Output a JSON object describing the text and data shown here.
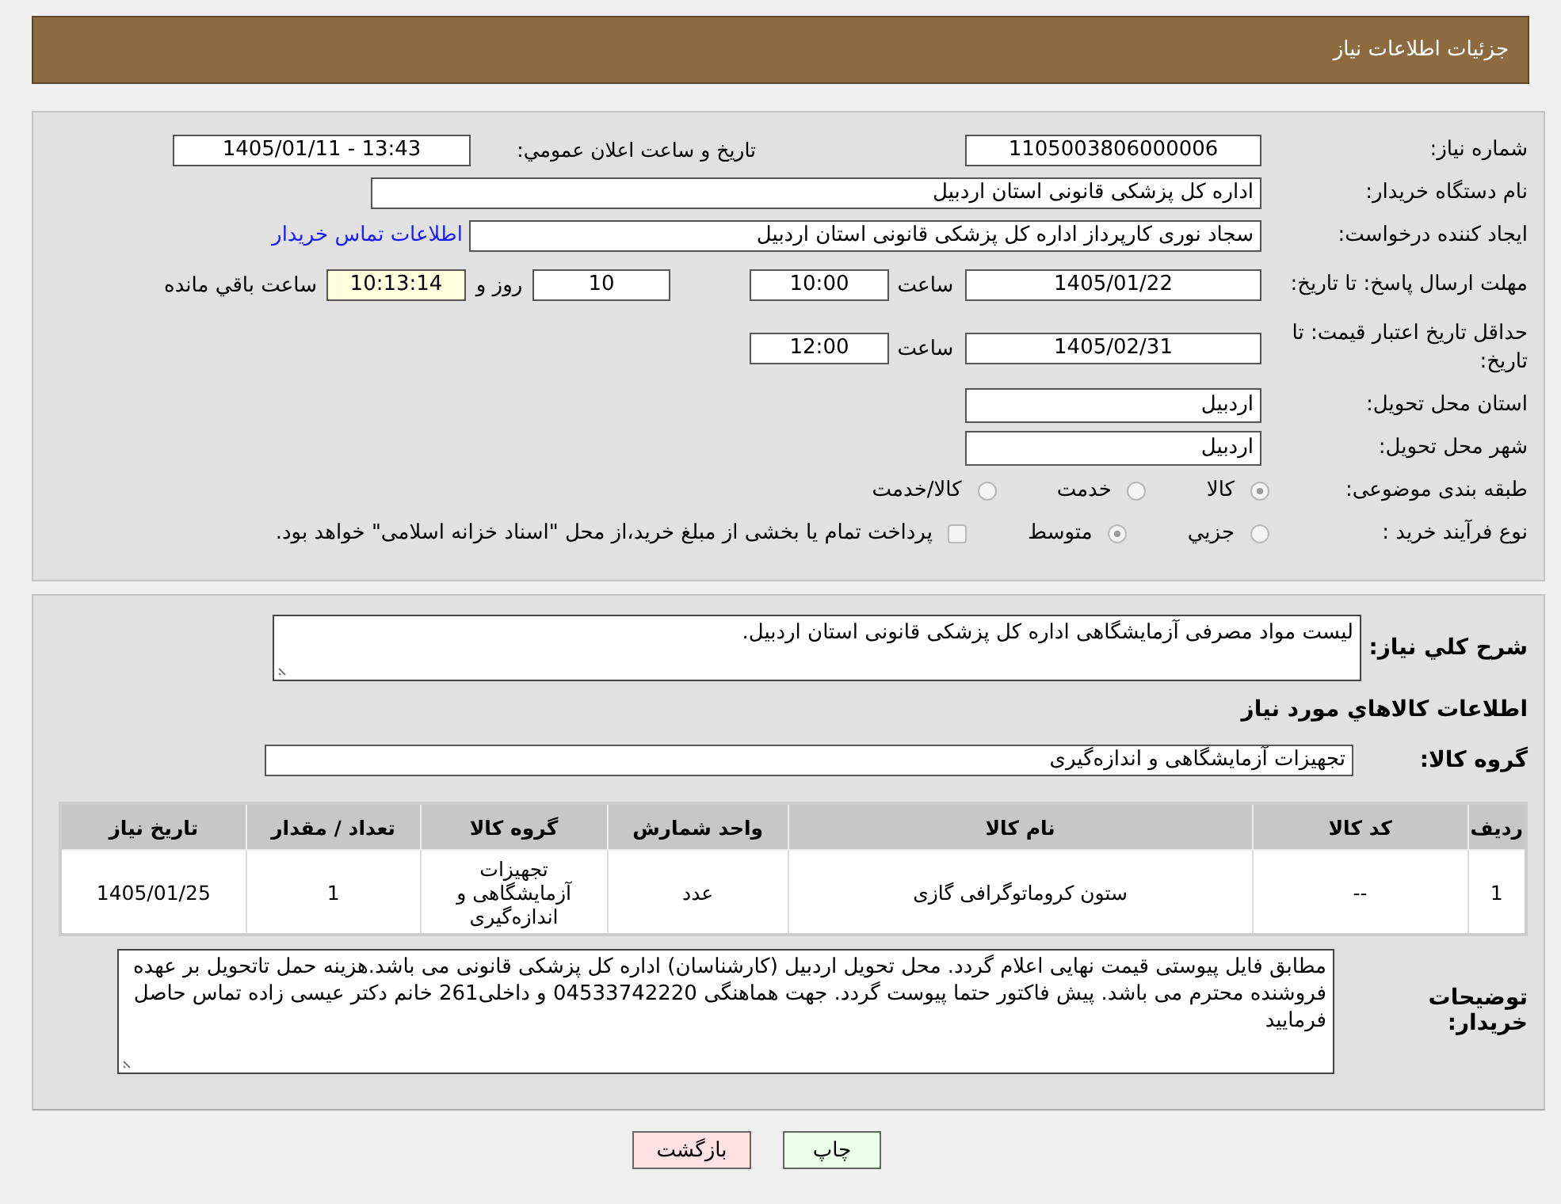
{
  "header": {
    "title": "جزئیات اطلاعات نیاز"
  },
  "need_number": {
    "label": "شماره نیاز:",
    "value": "1105003806000006"
  },
  "announce": {
    "label": "تاریخ و ساعت اعلان عمومي:",
    "value": "1405/01/11 - 13:43"
  },
  "buyer": {
    "label": "نام دستگاه خریدار:",
    "value": "اداره کل پزشکی قانونی استان اردبیل"
  },
  "requester": {
    "label": "ایجاد کننده درخواست:",
    "value": "سجاد نوری کارپرداز اداره کل پزشکی قانونی استان اردبیل",
    "link": "اطلاعات تماس خریدار"
  },
  "deadline": {
    "label": "مهلت ارسال پاسخ: تا تاریخ:",
    "date": "1405/01/22",
    "time_label": "ساعت",
    "time": "10:00",
    "days": "10",
    "days_label": "روز و",
    "remaining": "10:13:14",
    "remaining_label": "ساعت باقي مانده"
  },
  "validity": {
    "label": "حداقل تاریخ اعتبار قیمت: تا تاریخ:",
    "date": "1405/02/31",
    "time_label": "ساعت",
    "time": "12:00"
  },
  "province": {
    "label": "استان محل تحویل:",
    "value": "اردبیل"
  },
  "city": {
    "label": "شهر محل تحویل:",
    "value": "اردبیل"
  },
  "category": {
    "label": "طبقه بندی موضوعی:",
    "options": [
      {
        "label": "کالا",
        "selected": true
      },
      {
        "label": "خدمت",
        "selected": false
      },
      {
        "label": "کالا/خدمت",
        "selected": false
      }
    ]
  },
  "process": {
    "label": "نوع فرآیند خرید :",
    "options": [
      {
        "label": "جزيي",
        "selected": false
      },
      {
        "label": "متوسط",
        "selected": true
      }
    ],
    "treasury": {
      "label": "پرداخت تمام یا بخشی از مبلغ خرید،از محل \"اسناد خزانه اسلامی\" خواهد بود.",
      "checked": false
    }
  },
  "description": {
    "label": "شرح کلي نياز:",
    "value": "لیست مواد مصرفی آزمایشگاهی اداره کل پزشکی قانونی استان اردبیل."
  },
  "goods_title": "اطلاعات کالاهاي مورد نياز",
  "goods_group": {
    "label": "گروه کالا:",
    "value": "تجهیزات آزمایشگاهی و اندازه‌گیری"
  },
  "table": {
    "columns": [
      "ردیف",
      "کد کالا",
      "نام کالا",
      "واحد شمارش",
      "گروه کالا",
      "تعداد / مقدار",
      "تاریخ نیاز"
    ],
    "rows": [
      [
        "1",
        "--",
        "ستون کروماتوگرافی گازی",
        "عدد",
        "تجهیزات آزمایشگاهی و اندازه‌گیری",
        "1",
        "1405/01/25"
      ]
    ]
  },
  "buyer_notes": {
    "label": "توضیحات خریدار:",
    "value": "مطابق فایل پیوستی قیمت نهایی اعلام گردد. محل تحویل اردبیل (کارشناسان) اداره کل پزشکی قانونی می باشد.هزینه حمل تاتحویل بر عهده فروشنده محترم می باشد. پیش فاکتور حتما پیوست گردد. جهت هماهنگی 04533742220 و داخلی261 خانم دکتر عیسی زاده تماس حاصل فرمایید"
  },
  "buttons": [
    {
      "label": "چاپ",
      "kind": "print"
    },
    {
      "label": "بازگشت",
      "kind": "back"
    }
  ]
}
